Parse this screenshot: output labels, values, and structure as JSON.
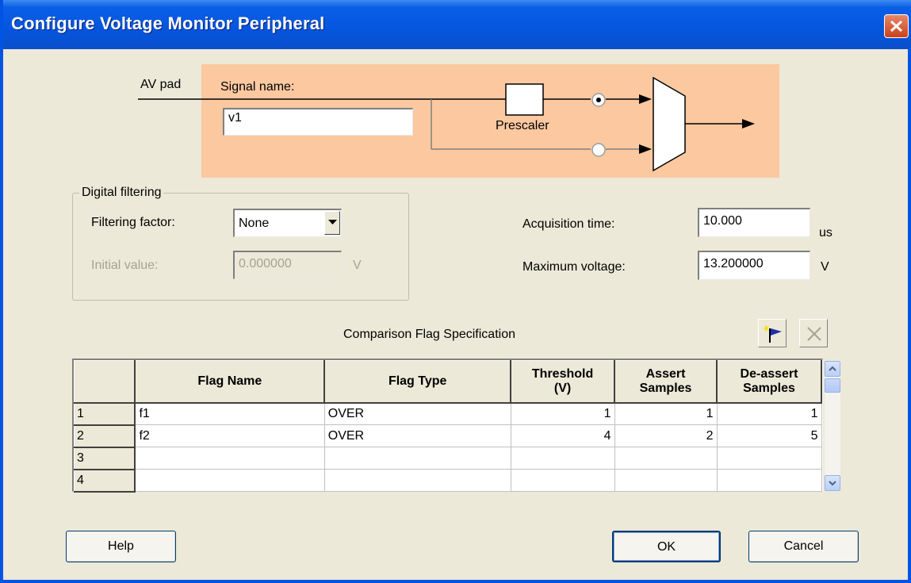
{
  "window": {
    "title": "Configure Voltage Monitor Peripheral",
    "close_icon": "close-icon"
  },
  "diagram": {
    "av_pad_label": "AV pad",
    "signal_name_label": "Signal name:",
    "signal_name_value": "v1",
    "prescaler_label": "Prescaler",
    "selected_path": "prescaler",
    "background_color": "#fbc8a0"
  },
  "digital_filtering": {
    "group_title": "Digital filtering",
    "filtering_factor_label": "Filtering factor:",
    "filtering_factor_value": "None",
    "initial_value_label": "Initial value:",
    "initial_value_value": "0.000000",
    "initial_value_unit": "V"
  },
  "acquisition": {
    "acquisition_time_label": "Acquisition  time:",
    "acquisition_time_value": "10.000",
    "acquisition_time_unit": "us",
    "max_voltage_label": "Maximum voltage:",
    "max_voltage_value": "13.200000",
    "max_voltage_unit": "V"
  },
  "flags": {
    "section_title": "Comparison Flag Specification",
    "add_flag_icon": "add-flag-icon",
    "delete_flag_icon": "delete-icon",
    "headers": {
      "flag_name": "Flag Name",
      "flag_type": "Flag Type",
      "threshold_1": "Threshold",
      "threshold_2": "(V)",
      "assert_1": "Assert",
      "assert_2": "Samples",
      "deassert_1": "De-assert",
      "deassert_2": "Samples"
    },
    "rows": [
      {
        "idx": "1",
        "name": "f1",
        "type": "OVER",
        "threshold": "1",
        "assert": "1",
        "deassert": "1"
      },
      {
        "idx": "2",
        "name": "f2",
        "type": "OVER",
        "threshold": "4",
        "assert": "2",
        "deassert": "5"
      },
      {
        "idx": "3",
        "name": "",
        "type": "",
        "threshold": "",
        "assert": "",
        "deassert": ""
      },
      {
        "idx": "4",
        "name": "",
        "type": "",
        "threshold": "",
        "assert": "",
        "deassert": ""
      }
    ]
  },
  "buttons": {
    "help": "Help",
    "ok": "OK",
    "cancel": "Cancel"
  },
  "colors": {
    "titlebar": "#0a5fe6",
    "dialog_bg": "#ece9d8"
  }
}
